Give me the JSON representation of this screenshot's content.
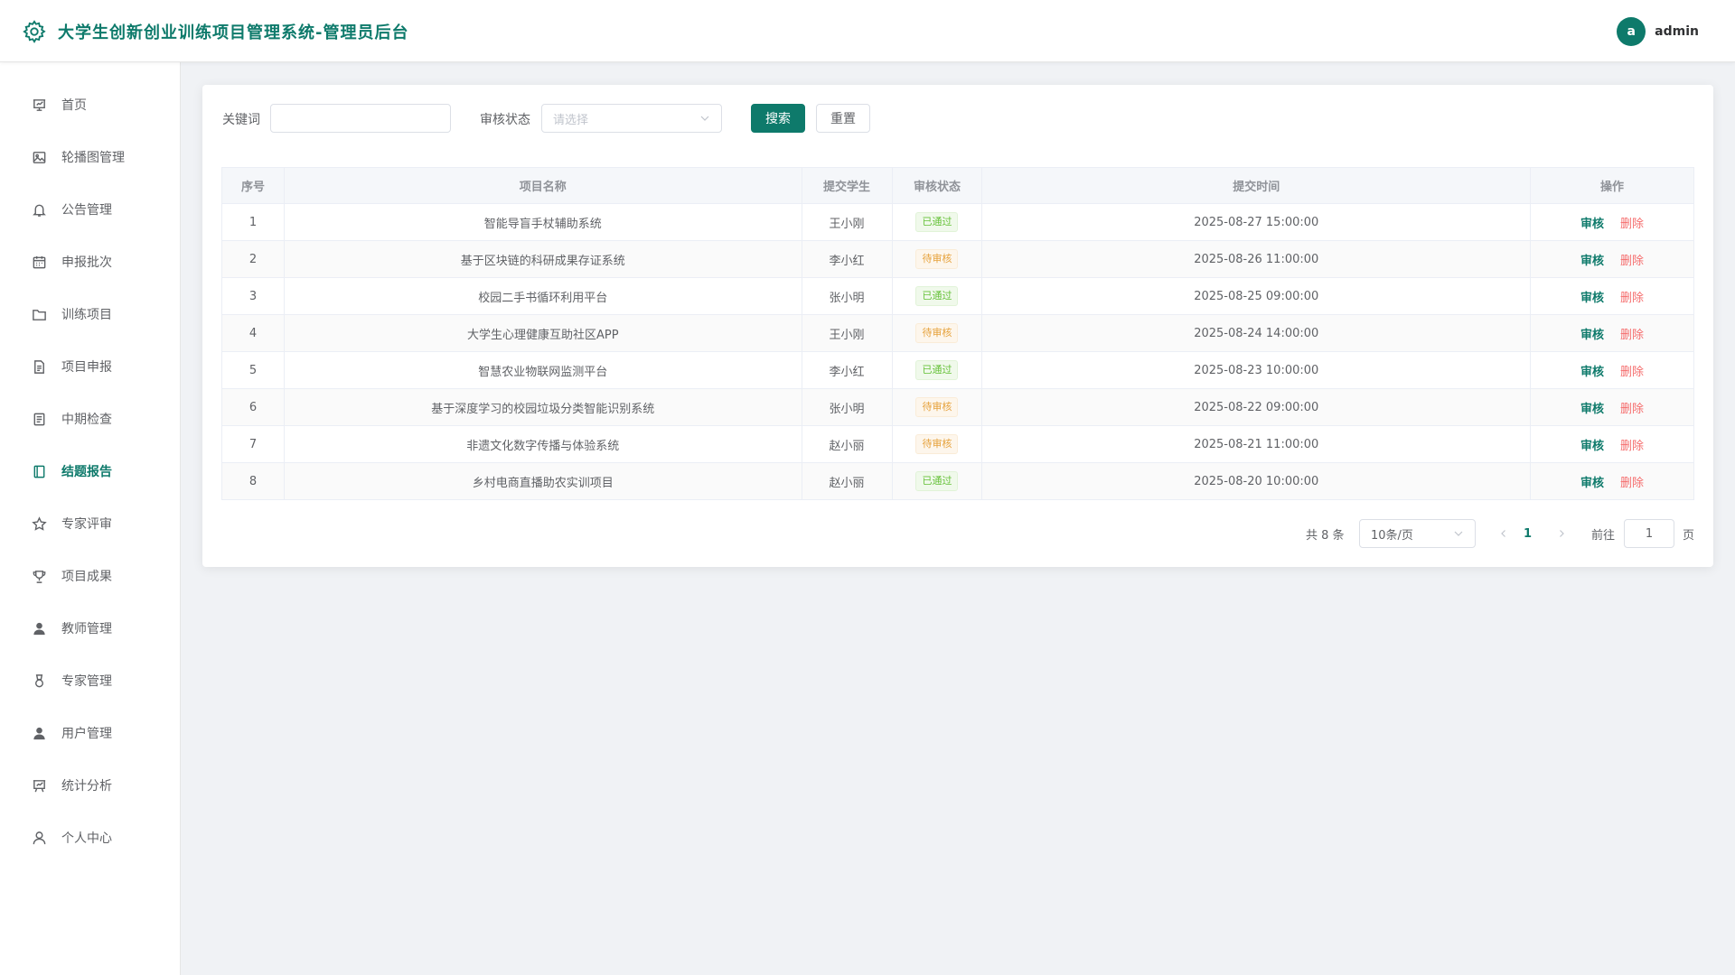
{
  "header": {
    "title": "大学生创新创业训练项目管理系统-管理员后台",
    "avatar_letter": "a",
    "username": "admin"
  },
  "sidebar": {
    "items": [
      {
        "label": "首页",
        "icon": "presentation-icon"
      },
      {
        "label": "轮播图管理",
        "icon": "picture-icon"
      },
      {
        "label": "公告管理",
        "icon": "bell-icon"
      },
      {
        "label": "申报批次",
        "icon": "calendar-icon"
      },
      {
        "label": "训练项目",
        "icon": "folder-icon"
      },
      {
        "label": "项目申报",
        "icon": "document-icon"
      },
      {
        "label": "中期检查",
        "icon": "tickets-icon"
      },
      {
        "label": "结题报告",
        "icon": "notebook-icon",
        "active": true
      },
      {
        "label": "专家评审",
        "icon": "star-icon"
      },
      {
        "label": "项目成果",
        "icon": "trophy-icon"
      },
      {
        "label": "教师管理",
        "icon": "user-solid-icon"
      },
      {
        "label": "专家管理",
        "icon": "medal-icon"
      },
      {
        "label": "用户管理",
        "icon": "user-solid-icon"
      },
      {
        "label": "统计分析",
        "icon": "data-board-icon"
      },
      {
        "label": "个人中心",
        "icon": "user-icon"
      }
    ]
  },
  "filters": {
    "keyword_label": "关键词",
    "keyword_value": "",
    "status_label": "审核状态",
    "status_placeholder": "请选择",
    "search_label": "搜索",
    "reset_label": "重置"
  },
  "table": {
    "columns": [
      "序号",
      "项目名称",
      "提交学生",
      "审核状态",
      "提交时间",
      "操作"
    ],
    "review_label": "审核",
    "delete_label": "删除",
    "rows": [
      {
        "index": "1",
        "name": "智能导盲手杖辅助系统",
        "student": "王小刚",
        "status": "已通过",
        "status_type": "pass",
        "time": "2025-08-27 15:00:00"
      },
      {
        "index": "2",
        "name": "基于区块链的科研成果存证系统",
        "student": "李小红",
        "status": "待审核",
        "status_type": "pending",
        "time": "2025-08-26 11:00:00"
      },
      {
        "index": "3",
        "name": "校园二手书循环利用平台",
        "student": "张小明",
        "status": "已通过",
        "status_type": "pass",
        "time": "2025-08-25 09:00:00"
      },
      {
        "index": "4",
        "name": "大学生心理健康互助社区APP",
        "student": "王小刚",
        "status": "待审核",
        "status_type": "pending",
        "time": "2025-08-24 14:00:00"
      },
      {
        "index": "5",
        "name": "智慧农业物联网监测平台",
        "student": "李小红",
        "status": "已通过",
        "status_type": "pass",
        "time": "2025-08-23 10:00:00"
      },
      {
        "index": "6",
        "name": "基于深度学习的校园垃圾分类智能识别系统",
        "student": "张小明",
        "status": "待审核",
        "status_type": "pending",
        "time": "2025-08-22 09:00:00"
      },
      {
        "index": "7",
        "name": "非遗文化数字传播与体验系统",
        "student": "赵小丽",
        "status": "待审核",
        "status_type": "pending",
        "time": "2025-08-21 11:00:00"
      },
      {
        "index": "8",
        "name": "乡村电商直播助农实训项目",
        "student": "赵小丽",
        "status": "已通过",
        "status_type": "pass",
        "time": "2025-08-20 10:00:00"
      }
    ]
  },
  "pagination": {
    "total_text": "共 8 条",
    "page_size": "10条/页",
    "current_page": "1",
    "goto_label": "前往",
    "goto_value": "1",
    "page_unit": "页"
  },
  "colors": {
    "primary": "#0e7a6b",
    "danger": "#f56c6c",
    "pass": "#67c23a",
    "pending": "#e6a23c"
  }
}
